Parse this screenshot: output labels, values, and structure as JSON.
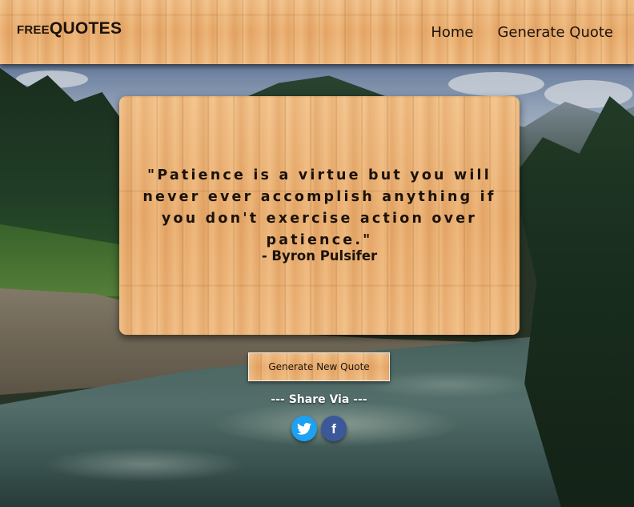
{
  "header": {
    "logo_prefix": "FREE",
    "logo_main": "QUOTES",
    "nav": [
      "Home",
      "Generate Quote"
    ]
  },
  "quote": {
    "text": "\"Patience is a virtue but you will never ever accomplish anything if you don't exercise action over patience.\"",
    "author": "- Byron Pulsifer"
  },
  "actions": {
    "generate_label": "Generate New Quote",
    "share_label": "--- Share Via ---"
  },
  "social": {
    "icons": [
      "twitter-icon",
      "facebook-icon"
    ],
    "facebook_glyph": "f"
  },
  "colors": {
    "twitter": "#1da1f2",
    "facebook": "#3b5998",
    "text_dark": "#1a120b"
  }
}
